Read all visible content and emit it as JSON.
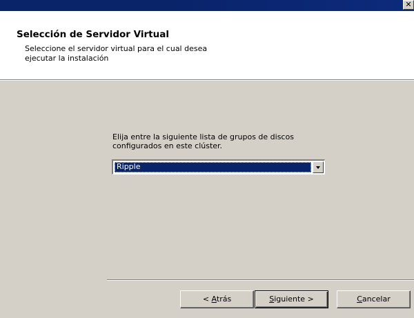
{
  "window": {
    "close_glyph": "✕"
  },
  "header": {
    "title": "Selección de Servidor Virtual",
    "subtitle": "Seleccione el servidor virtual para el cual desea ejecutar la instalación"
  },
  "main": {
    "instruction": "Elija entre la siguiente lista de grupos de discos configurados en este clúster.",
    "disk_group_select": {
      "selected_value": "Ripple"
    }
  },
  "buttons": {
    "back": {
      "prefix": "< ",
      "mnemonic": "A",
      "rest": "trás"
    },
    "next": {
      "mnemonic": "S",
      "rest": "iguiente >"
    },
    "cancel": {
      "mnemonic": "C",
      "rest": "ancelar"
    }
  },
  "colors": {
    "titlebar": "#0a246a",
    "dialog_bg": "#d4d0c8",
    "selection": "#0a246a"
  }
}
